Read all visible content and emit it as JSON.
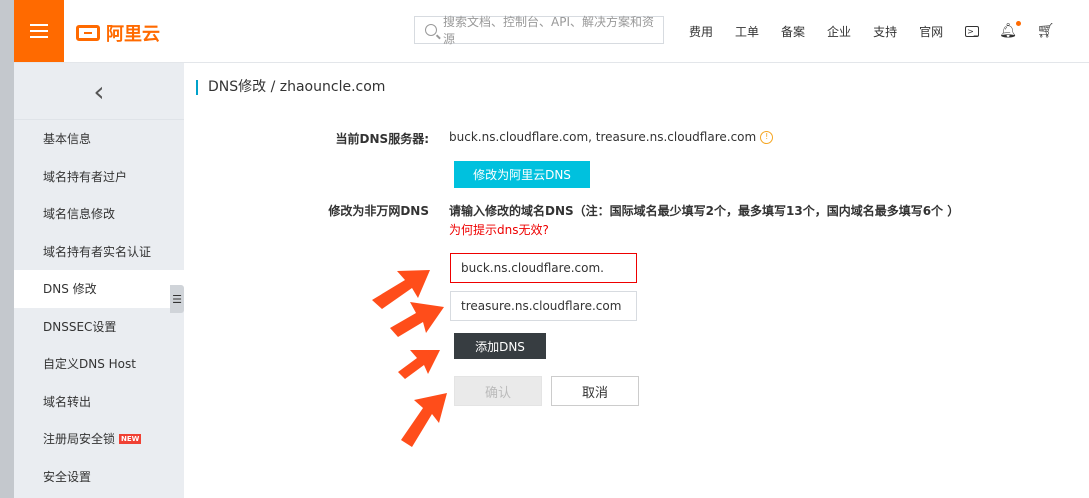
{
  "header": {
    "brand_name": "阿里云",
    "search_placeholder": "搜索文档、控制台、API、解决方案和资源",
    "nav": [
      "费用",
      "工单",
      "备案",
      "企业",
      "支持",
      "官网"
    ]
  },
  "sidebar": {
    "items": [
      {
        "label": "基本信息"
      },
      {
        "label": "域名持有者过户"
      },
      {
        "label": "域名信息修改"
      },
      {
        "label": "域名持有者实名认证"
      },
      {
        "label": "DNS 修改"
      },
      {
        "label": "DNSSEC设置"
      },
      {
        "label": "自定义DNS Host"
      },
      {
        "label": "域名转出"
      },
      {
        "label": "注册局安全锁"
      },
      {
        "label": "安全设置"
      }
    ],
    "active_index": 4,
    "new_badge": "NEW"
  },
  "main": {
    "title": "DNS修改 / zhaouncle.com",
    "current_dns_label": "当前DNS服务器:",
    "current_dns_value": "buck.ns.cloudflare.com, treasure.ns.cloudflare.com",
    "switch_button": "修改为阿里云DNS",
    "non_wanwang_label": "修改为非万网DNS",
    "instruction": "请输入修改的域名DNS（注：国际域名最少填写2个，最多填写13个，国内域名最多填写6个 ）",
    "help_link": "为何提示dns无效?",
    "dns_inputs": [
      "buck.ns.cloudflare.com.",
      "treasure.ns.cloudflare.com"
    ],
    "add_button": "添加DNS",
    "confirm_button": "确认",
    "cancel_button": "取消"
  },
  "colors": {
    "brand": "#ff6a00",
    "accent": "#00c1de",
    "annotation_arrow": "#ff4d1a"
  }
}
